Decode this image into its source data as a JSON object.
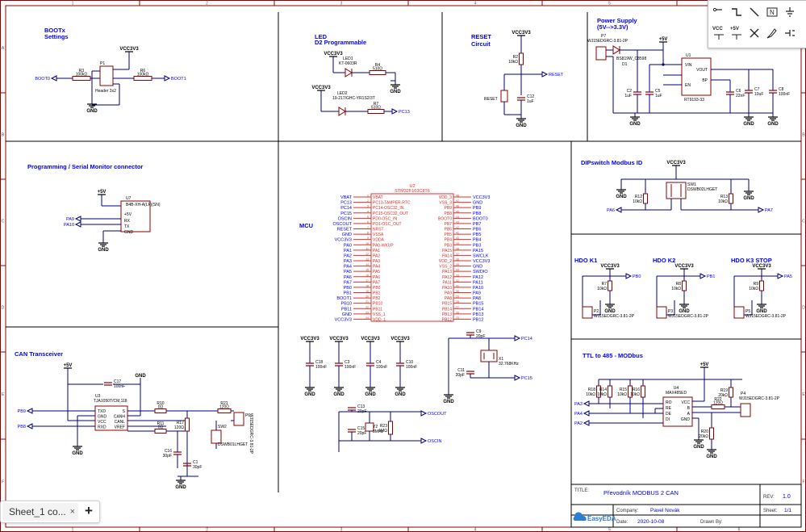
{
  "toolbar": {
    "label_vcc": "VCC",
    "label_5v": "+5V"
  },
  "tabs": {
    "sheet_label": "Sheet_1 co...",
    "close": "×",
    "add": "+"
  },
  "frame": {
    "cols": [
      "1",
      "2",
      "3",
      "4",
      "5",
      "6"
    ],
    "rows": [
      "A",
      "B",
      "C",
      "D",
      "E",
      "F"
    ]
  },
  "sections": {
    "bootx": "BOOTx",
    "bootx2": "Settings",
    "led": "LED",
    "led2": "D2 Programmable",
    "reset": "RESET",
    "reset2": "Circuit",
    "power": "Power Supply",
    "power2": "(5V-->3.3V)",
    "prog": "Programming / Serial Monitor connector",
    "mcu": "MCU",
    "dip": "DIPswitch Modbus ID",
    "hdo1": "HDO K1",
    "hdo2": "HDO K2",
    "hdo3": "HDO K3 STOP",
    "can": "CAN Transceiver",
    "ttl": "TTL to 485 - MODbus"
  },
  "nets": {
    "vcc3v3": "VCC3V3",
    "p5v": "+5V",
    "gnd": "GND",
    "boot0": "BOOT0",
    "boot1": "BOOT1",
    "reset": "RESET",
    "pc13": "PC13",
    "pa6": "PA6",
    "pa7": "PA7",
    "pa9": "PA9",
    "pa10": "PA10",
    "pb0": "PB0",
    "pb1": "PB1",
    "pa5": "PA5",
    "pb9": "PB9",
    "pb8": "PB8",
    "pa3": "PA3",
    "pa4": "PA4",
    "pa2": "PA2",
    "pc14": "PC14",
    "pc15": "PC15",
    "oscout": "OSCOUT",
    "oscin": "OSCIN"
  },
  "parts": {
    "r3": "R3",
    "r3v": "100kΩ",
    "p1": "P1",
    "p1v": "Header 3x2",
    "r6": "R6",
    "r6v": "100kΩ",
    "led1": "LED1",
    "led1v": "KT-0603R",
    "r4": "R4",
    "r4v": "510Ω",
    "led2": "LED2",
    "led2v": "19-217/GHC-YR1S2/3T",
    "r7": "R7",
    "r7v": "510Ω",
    "r2": "R2",
    "r2v": "10kΩ",
    "c12": "C12",
    "c12v": "1uF",
    "reset_sw": "RESET",
    "p7": "P7",
    "p7v": "WJ15EDGRC-3.81-2P",
    "d1": "D1",
    "d1v": "BS819W_C8598",
    "u1": "U1",
    "u1v": "RT9193-33",
    "u1_vin": "VIN",
    "u1_vout": "VOUT",
    "u1_en": "EN",
    "u1_bp": "BP",
    "c2": "C2",
    "c2v": "1uF",
    "c5": "C5",
    "c5v": "1uF",
    "c6": "C6",
    "c6v": "22nF",
    "c7": "C7",
    "c7v": "10uF",
    "c8": "C8",
    "c8v": "100nF",
    "u7": "U7",
    "u7v": "B4B-XH-A(LF)(SN)",
    "u7_5v": "+5V",
    "u7_rx": "RX",
    "u7_tx": "TX",
    "u7_gnd": "GND",
    "u2": "U2",
    "u2v": "STM32F103C8T6",
    "sw1": "SW1",
    "sw1v": "DSWB02LHGET",
    "r12": "R12",
    "r12v": "10kΩ",
    "r13": "R13",
    "r13v": "10kΩ",
    "r9": "R9",
    "r9v": "10kΩ",
    "r8": "R8",
    "r8v": "10kΩ",
    "r5": "R5",
    "r5v": "10kΩ",
    "p2": "P2",
    "p2v": "WJ15EDGRC-3.81-2P",
    "p3": "P3",
    "p3v": "WJ15EDGRC-3.81-2P",
    "p5": "P5",
    "p5v": "WJ15EDGRC-3.81-2P",
    "c18": "C18",
    "c18v": "100nF",
    "c3": "C3",
    "c3v": "100nF",
    "c4": "C4",
    "c4v": "100nF",
    "c10": "C10",
    "c10v": "100nF",
    "c9": "C9",
    "c9v": "20pF",
    "c11": "C11",
    "c11v": "20pF",
    "x1": "X1",
    "x1v": "32.768KHz",
    "c13": "C13",
    "c13v": "20pF",
    "c15": "C15",
    "c15v": "20pF",
    "y2": "Y2",
    "y2v": "8MHz",
    "r23": "R23",
    "r23v": "1MΩ",
    "c17": "C17",
    "c17v": "100nF",
    "u3": "U3",
    "u3v": "TJA1050T/CM,118",
    "u3_txd": "TXD",
    "u3_gnd": "GND",
    "u3_vcc": "VCC",
    "u3_rxd": "RXD",
    "u3_s": "S",
    "u3_canh": "CANH",
    "u3_canl": "CANL",
    "u3_vref": "VREF",
    "r10": "R10",
    "r10v": "0Ω",
    "r11": "R11",
    "r11v": "0Ω",
    "r17": "R17",
    "r17v": "120Ω",
    "c16": "C16",
    "c16v": "30pF",
    "c1": "C1",
    "c1v": "30pF",
    "r21": "R21",
    "r21v": "120Ω",
    "sw2": "SW2",
    "sw2v": "DSWB01LHGET",
    "p6": "P6",
    "p6v": "WJ15EDGRC-3.81-2P",
    "u4": "U4",
    "u4v": "MAX485ED",
    "u4_ro": "RO",
    "u4_re": "RE",
    "u4_de": "DE",
    "u4_di": "DI",
    "u4_vcc": "VCC",
    "u4_b": "B",
    "u4_a": "A",
    "u4_gnd": "GND",
    "r18": "R18",
    "r18v": "10kΩ",
    "r14": "R14",
    "r14v": "10kΩ",
    "r15": "R15",
    "r15v": "10kΩ",
    "r16": "R16",
    "r16v": "10kΩ",
    "r19": "R19",
    "r19v": "20kΩ",
    "r22": "R22",
    "r22v": "120Ω",
    "r20": "R20",
    "r20v": "20kΩ",
    "p4": "P4",
    "p4v": "WJ15EDGRC-3.81-2P"
  },
  "mcu_left": [
    "VBAT",
    "PC13",
    "PC14",
    "PC15",
    "OSCIN",
    "OSCOUT",
    "RESET",
    "GND",
    "VCC3V3",
    "PA0",
    "PA1",
    "PA2",
    "PA3",
    "PA4",
    "PA5",
    "PA6",
    "PA7",
    "PB0",
    "PB1",
    "BOOT1",
    "PB10",
    "PB11",
    "GND",
    "VCC3V3"
  ],
  "mcu_left_int": [
    "VBAT",
    "PC13-TAMPER-RTC",
    "PC14-OSC32_IN",
    "PC15-OSC32_OUT",
    "PD0-OSC_IN",
    "PD1-OSC_OUT",
    "NRST",
    "VSSA",
    "VDDA",
    "PA0-WKUP",
    "PA1",
    "PA2",
    "PA3",
    "PA4",
    "PA5",
    "PA6",
    "PA7",
    "PB0",
    "PB1",
    "PB2",
    "PB10",
    "PB11",
    "VSS_1",
    "VDD_1"
  ],
  "mcu_right": [
    "VCC3V3",
    "GND",
    "PB9",
    "PB8",
    "BOOT0",
    "PB7",
    "PB6",
    "PB5",
    "PB4",
    "PB3",
    "PA15",
    "SWCLK",
    "VCC3V3",
    "GND",
    "SWDIO",
    "PA12",
    "PA11",
    "PA10",
    "PA9",
    "PA8",
    "PB15",
    "PB14",
    "PB13",
    "PB12"
  ],
  "mcu_right_int": [
    "VDD_3",
    "VSS_3",
    "PB9",
    "PB8",
    "BOOT0",
    "PB7",
    "PB6",
    "PB5",
    "PB4",
    "PB3",
    "PA15",
    "PA14",
    "VDD_2",
    "VSS_2",
    "PA13",
    "PA12",
    "PA11",
    "PA10",
    "PA9",
    "PA8",
    "PB15",
    "PB14",
    "PB13",
    "PB12"
  ],
  "mcu_left_nums": [
    "1",
    "2",
    "3",
    "4",
    "5",
    "6",
    "7",
    "8",
    "9",
    "10",
    "11",
    "12",
    "13",
    "14",
    "15",
    "16",
    "17",
    "18",
    "19",
    "20",
    "21",
    "22",
    "23",
    "24"
  ],
  "mcu_right_nums": [
    "48",
    "47",
    "46",
    "45",
    "44",
    "43",
    "42",
    "41",
    "40",
    "39",
    "38",
    "37",
    "36",
    "35",
    "34",
    "33",
    "32",
    "31",
    "30",
    "29",
    "28",
    "27",
    "26",
    "25"
  ],
  "titleblock": {
    "title_label": "TITLE:",
    "title": "Převodník MODBUS 2 CAN",
    "rev_label": "REV:",
    "rev": "1.0",
    "company_label": "Company:",
    "company": "Pavel Novák",
    "sheet_label": "Sheet:",
    "sheet": "1/1",
    "date_label": "Date:",
    "date": "2020-10-08",
    "drawn_label": "Drawn By:",
    "logo": "EasyEDA"
  },
  "colors": {
    "frame": "#8b0000",
    "wire": "#000080",
    "part": "#8b0000",
    "net": "#0000ff",
    "mcu": "#e0302a",
    "title": "#0000ff"
  }
}
